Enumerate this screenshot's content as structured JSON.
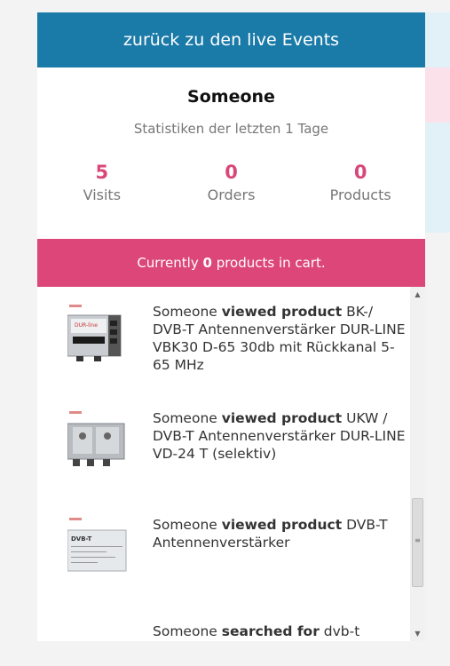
{
  "header": {
    "back_label": "zurück zu den live Events"
  },
  "user": {
    "name": "Someone",
    "subtitle": "Statistiken der letzten 1 Tage"
  },
  "stats": [
    {
      "value": "5",
      "label": "Visits"
    },
    {
      "value": "0",
      "label": "Orders"
    },
    {
      "value": "0",
      "label": "Products"
    }
  ],
  "cart": {
    "prefix": "Currently",
    "count": "0",
    "suffix": "products in cart."
  },
  "feed": [
    {
      "actor": "Someone",
      "action": "viewed product",
      "target": "BK-/ DVB-T Antennenverstärker DUR-LINE VBK30 D-65 30db mit Rückkanal 5-65 MHz",
      "thumb_icon": "amplifier-product-thumbnail"
    },
    {
      "actor": "Someone",
      "action": "viewed product",
      "target": "UKW / DVB-T Antennenverstärker DUR-LINE VD-24 T (selektiv)",
      "thumb_icon": "amplifier-product-thumbnail"
    },
    {
      "actor": "Someone",
      "action": "viewed product",
      "target": "DVB-T Antennenverstärker",
      "thumb_icon": "amplifier-product-thumbnail"
    },
    {
      "actor": "Someone",
      "action": "searched for",
      "target": "dvb-t antenne"
    }
  ],
  "colors": {
    "header_blue": "#1a7aa8",
    "accent_pink": "#dc4678",
    "stat_pink": "#d9467a"
  }
}
